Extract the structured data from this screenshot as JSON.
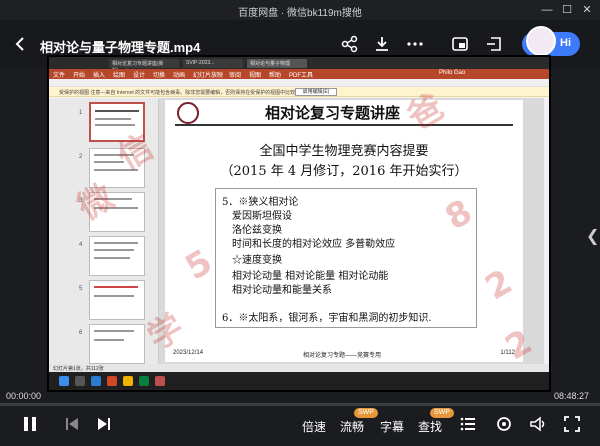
{
  "window": {
    "title": "百度网盘 · 微信bk119m搜他"
  },
  "player": {
    "video_title": "相对论与量子物理专题.mp4",
    "hi_label": "Hi",
    "time_current": "00:00:00",
    "time_total": "08:48:27",
    "controls": {
      "speed": "倍速",
      "smooth": "流畅",
      "subtitle": "字幕",
      "find": "查找",
      "badge_swp": "SWP"
    }
  },
  "ppt": {
    "tabs": [
      "相对论复习专题讲座(新版).pptx",
      "SVIP-2023...",
      "相对论与量子物理"
    ],
    "menu": [
      "文件",
      "开始",
      "插入",
      "绘图",
      "设计",
      "切换",
      "动画",
      "幻灯片放映",
      "审阅",
      "视图",
      "帮助",
      "PDF工具"
    ],
    "user": "Philo Gao",
    "warning": "受保护的视图  注意—来自 Internet 的文件可能包含病毒。除非您需要编辑，否则保持在受保护的视图中比较安全。",
    "warning_button": "启用编辑(E)",
    "slide_numbers": [
      "1",
      "2",
      "3",
      "4",
      "5",
      "6"
    ],
    "slide": {
      "title": "相对论复习专题讲座",
      "subtitle_1": "全国中学生物理竞赛内容提要",
      "subtitle_2": "（2015 年 4 月修订，2016 年开始实行）",
      "lines": [
        "5．※狭义相对论",
        "爱因斯坦假设",
        "洛伦兹变换",
        "时间和长度的相对论效应  多普勒效应",
        "☆速度变换",
        "相对论动量    相对论能量    相对论动能",
        "相对论动量和能量关系",
        "6．※太阳系，银河系，宇宙和黑洞的初步知识."
      ],
      "footer_date": "2023/12/14",
      "footer_center": "相对论复习专题——竞赛专用",
      "footer_page": "1/112"
    },
    "status": "幻灯片第1张，共112张"
  },
  "watermark": [
    "微",
    "信",
    "5",
    "8",
    "2",
    "2",
    "学",
    "爸"
  ],
  "colors": {
    "accent": "#3d7bfa",
    "ppt_red": "#b7472a",
    "badge": "#e8963a"
  }
}
